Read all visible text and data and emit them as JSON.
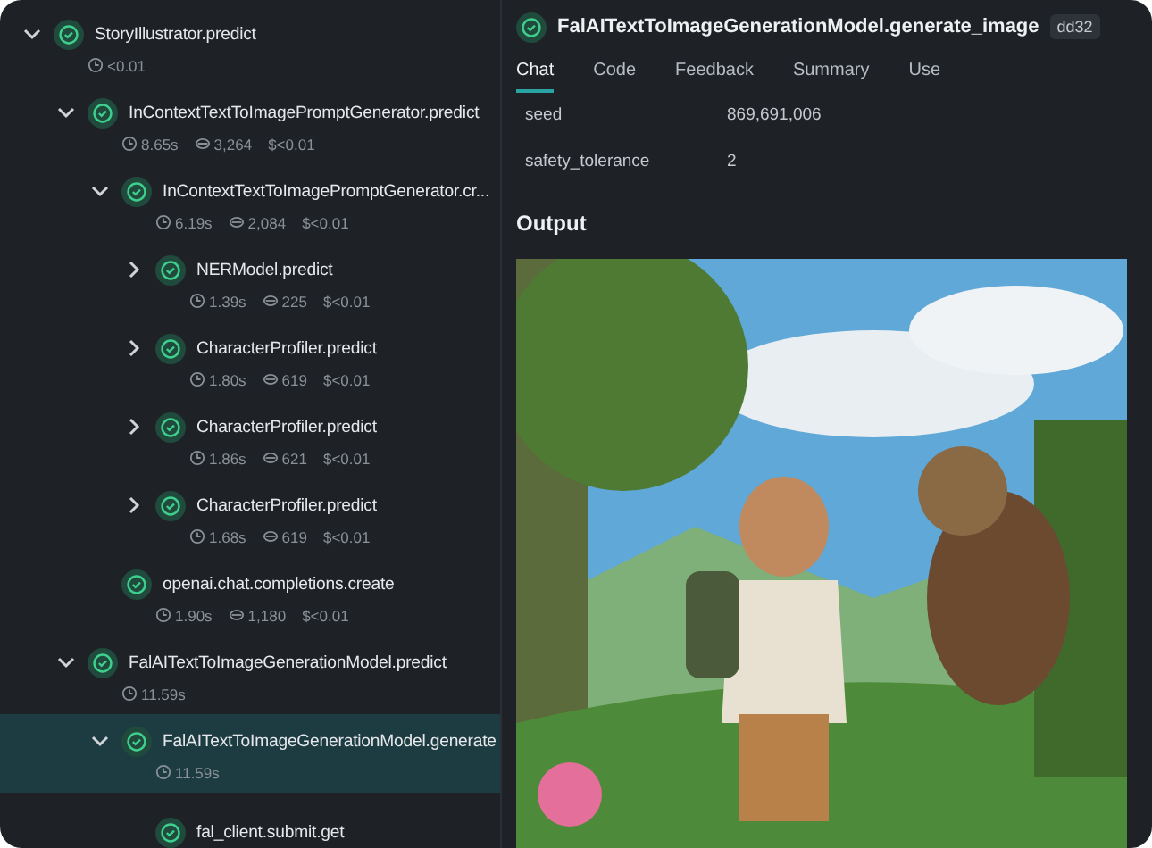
{
  "trace": [
    {
      "name": "StoryIllustrator.predict",
      "expanded": true,
      "selected": false,
      "time": "<0.01",
      "children": [
        {
          "name": "InContextTextToImagePromptGenerator.predict",
          "expanded": true,
          "selected": false,
          "time": "8.65s",
          "tokens": "3,264",
          "cost": "$<0.01",
          "children": [
            {
              "name": "InContextTextToImagePromptGenerator.cr...",
              "expanded": true,
              "selected": false,
              "time": "6.19s",
              "tokens": "2,084",
              "cost": "$<0.01",
              "children": [
                {
                  "name": "NERModel.predict",
                  "expanded": false,
                  "selected": false,
                  "time": "1.39s",
                  "tokens": "225",
                  "cost": "$<0.01"
                },
                {
                  "name": "CharacterProfiler.predict",
                  "expanded": false,
                  "selected": false,
                  "time": "1.80s",
                  "tokens": "619",
                  "cost": "$<0.01"
                },
                {
                  "name": "CharacterProfiler.predict",
                  "expanded": false,
                  "selected": false,
                  "time": "1.86s",
                  "tokens": "621",
                  "cost": "$<0.01"
                },
                {
                  "name": "CharacterProfiler.predict",
                  "expanded": false,
                  "selected": false,
                  "time": "1.68s",
                  "tokens": "619",
                  "cost": "$<0.01"
                }
              ]
            },
            {
              "name": "openai.chat.completions.create",
              "selected": false,
              "time": "1.90s",
              "tokens": "1,180",
              "cost": "$<0.01"
            }
          ]
        },
        {
          "name": "FalAITextToImageGenerationModel.predict",
          "expanded": true,
          "selected": false,
          "time": "11.59s",
          "children": [
            {
              "name": "FalAITextToImageGenerationModel.generate",
              "expanded": true,
              "selected": true,
              "time": "11.59s",
              "children": [
                {
                  "name": "fal_client.submit.get",
                  "selected": false
                }
              ]
            }
          ]
        }
      ]
    }
  ],
  "detail": {
    "title": "FalAITextToImageGenerationModel.generate_image",
    "badge": "dd32",
    "tabs": [
      {
        "label": "Chat",
        "selected": true
      },
      {
        "label": "Code",
        "selected": false
      },
      {
        "label": "Feedback",
        "selected": false
      },
      {
        "label": "Summary",
        "selected": false
      },
      {
        "label": "Use",
        "selected": false
      }
    ],
    "params": [
      {
        "key": "seed",
        "value": "869,691,006"
      },
      {
        "key": "safety_tolerance",
        "value": "2"
      }
    ],
    "output_heading": "Output"
  }
}
